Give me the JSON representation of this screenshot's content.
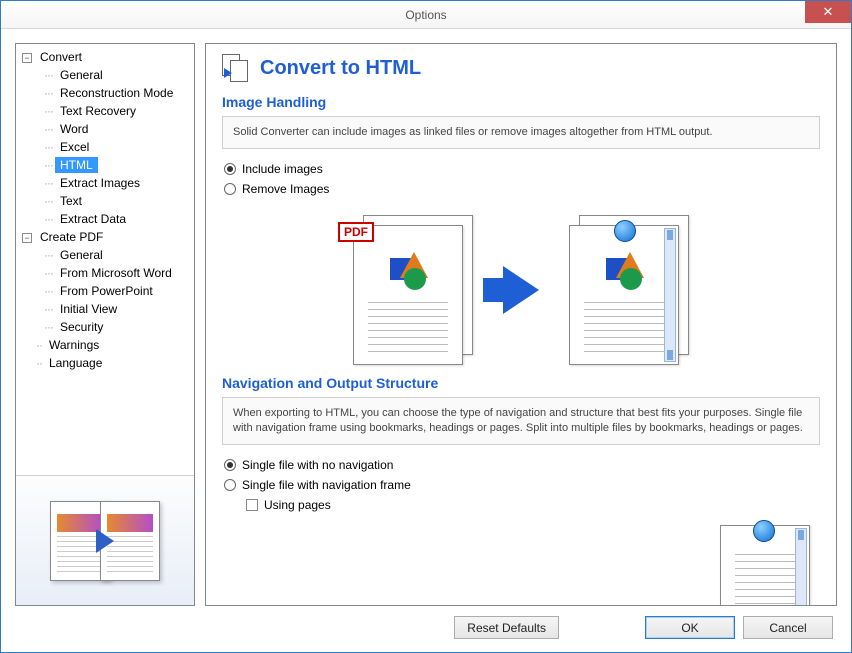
{
  "window": {
    "title": "Options"
  },
  "tree": {
    "groups": [
      {
        "label": "Convert",
        "children": [
          "General",
          "Reconstruction Mode",
          "Text Recovery",
          "Word",
          "Excel",
          "HTML",
          "Extract Images",
          "Text",
          "Extract Data"
        ],
        "selectedChild": "HTML"
      },
      {
        "label": "Create PDF",
        "children": [
          "General",
          "From Microsoft Word",
          "From PowerPoint",
          "Initial View",
          "Security"
        ]
      }
    ],
    "top": [
      "Warnings",
      "Language"
    ]
  },
  "page": {
    "title": "Convert to HTML",
    "sections": {
      "imageHandling": {
        "title": "Image Handling",
        "info": "Solid Converter can include images as linked files or remove images altogether from HTML output.",
        "options": {
          "include": "Include images",
          "remove": "Remove Images"
        },
        "pdfBadge": "PDF"
      },
      "navStructure": {
        "title": "Navigation and Output Structure",
        "info": "When exporting to HTML, you can choose the type of navigation and structure that best fits your purposes. Single file with navigation frame using bookmarks, headings or pages. Split into multiple files by bookmarks, headings or pages.",
        "options": {
          "noNav": "Single file with no navigation",
          "withNav": "Single file with navigation frame",
          "usingPages": "Using pages"
        }
      }
    }
  },
  "buttons": {
    "reset": "Reset Defaults",
    "ok": "OK",
    "cancel": "Cancel"
  }
}
